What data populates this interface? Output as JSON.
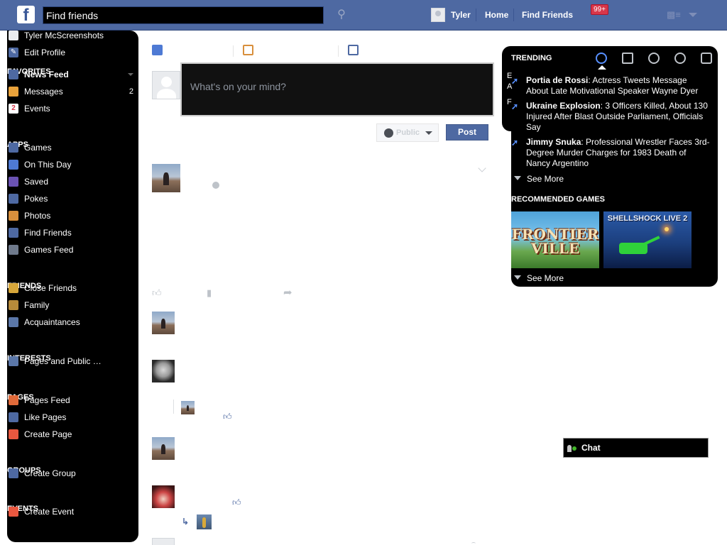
{
  "topbar": {
    "logo": "f",
    "search_value": "Find friends",
    "user_name": "Tyler",
    "home_link": "Home",
    "find_friends_link": "Find Friends",
    "notifications_badge": "99+"
  },
  "sidebar": {
    "profile_name": "Tyler McScreenshots",
    "edit_profile": "Edit Profile",
    "favorites_header": "FAVORITES",
    "favorites": [
      {
        "label": "News Feed",
        "icon": "news-feed-icon",
        "color": "#4e69a2"
      },
      {
        "label": "Messages",
        "count": "2",
        "icon": "messages-icon",
        "color": "#e9a23b"
      },
      {
        "label": "Events",
        "icon": "events-icon",
        "color": "#ffffff",
        "glyph": "2"
      }
    ],
    "apps_header": "APPS",
    "apps": [
      {
        "label": "Games",
        "icon": "games-icon",
        "color": "#4e69a2"
      },
      {
        "label": "On This Day",
        "icon": "on-this-day-icon",
        "color": "#4e7ad4"
      },
      {
        "label": "Saved",
        "icon": "saved-icon",
        "color": "#6a52b3"
      },
      {
        "label": "Pokes",
        "icon": "pokes-icon",
        "color": "#4e69a2"
      },
      {
        "label": "Photos",
        "icon": "photos-icon",
        "color": "#d88f3c"
      },
      {
        "label": "Find Friends",
        "icon": "find-friends-icon",
        "color": "#4e69a2"
      },
      {
        "label": "Games Feed",
        "icon": "games-feed-icon",
        "color": "#6f7a8c"
      }
    ],
    "friends_header": "FRIENDS",
    "friends": [
      {
        "label": "Close Friends",
        "icon": "close-friends-icon",
        "color": "#d6a63a"
      },
      {
        "label": "Family",
        "icon": "family-icon",
        "color": "#b78b3a"
      },
      {
        "label": "Acquaintances",
        "icon": "acquaintances-icon",
        "color": "#5b77a8"
      }
    ],
    "interests_header": "INTERESTS",
    "interests": [
      {
        "label": "Pages and Public …",
        "icon": "pages-public-icon",
        "color": "#5b77a8"
      }
    ],
    "pages_header": "PAGES",
    "pages": [
      {
        "label": "Pages Feed",
        "icon": "pages-feed-icon",
        "color": "#e06a3a"
      },
      {
        "label": "Like Pages",
        "icon": "like-pages-icon",
        "color": "#4e69a2"
      },
      {
        "label": "Create Page",
        "icon": "create-page-icon",
        "color": "#e9573f"
      }
    ],
    "groups_header": "GROUPS",
    "groups": [
      {
        "label": "Create Group",
        "icon": "create-group-icon",
        "color": "#4e69a2"
      }
    ],
    "events_header": "EVENTS",
    "events": [
      {
        "label": "Create Event",
        "icon": "create-event-icon",
        "color": "#e9573f"
      }
    ]
  },
  "composer": {
    "placeholder": "What's on your mind?",
    "privacy_label": "Public",
    "post_button": "Post"
  },
  "trending": {
    "title": "TRENDING",
    "edge_letters": [
      "E",
      "A",
      "F"
    ],
    "items": [
      {
        "topic": "Portia de Rossi",
        "text": ": Actress Tweets Message About Late Motivational Speaker Wayne Dyer"
      },
      {
        "topic": "Ukraine Explosion",
        "text": ": 3 Officers Killed, About 130 Injured After Blast Outside Parliament, Officials Say"
      },
      {
        "topic": "Jimmy Snuka",
        "text": ": Professional Wrestler Faces 3rd-Degree Murder Charges for 1983 Death of Nancy Argentino"
      }
    ],
    "see_more": "See More"
  },
  "recommended_games": {
    "title": "RECOMMENDED GAMES",
    "games": [
      {
        "name": "FRONTIER VILLE",
        "line1": "FRONTIER",
        "line2": "VILLE"
      },
      {
        "name": "SHELLSHOCK LIVE 2"
      }
    ],
    "see_more": "See More"
  },
  "chat": {
    "label": "Chat"
  },
  "colors": {
    "topbar": "#4e69a2",
    "post_button": "#4e69a2",
    "badge": "#d8374a",
    "trend_arrow": "#5890ff"
  }
}
